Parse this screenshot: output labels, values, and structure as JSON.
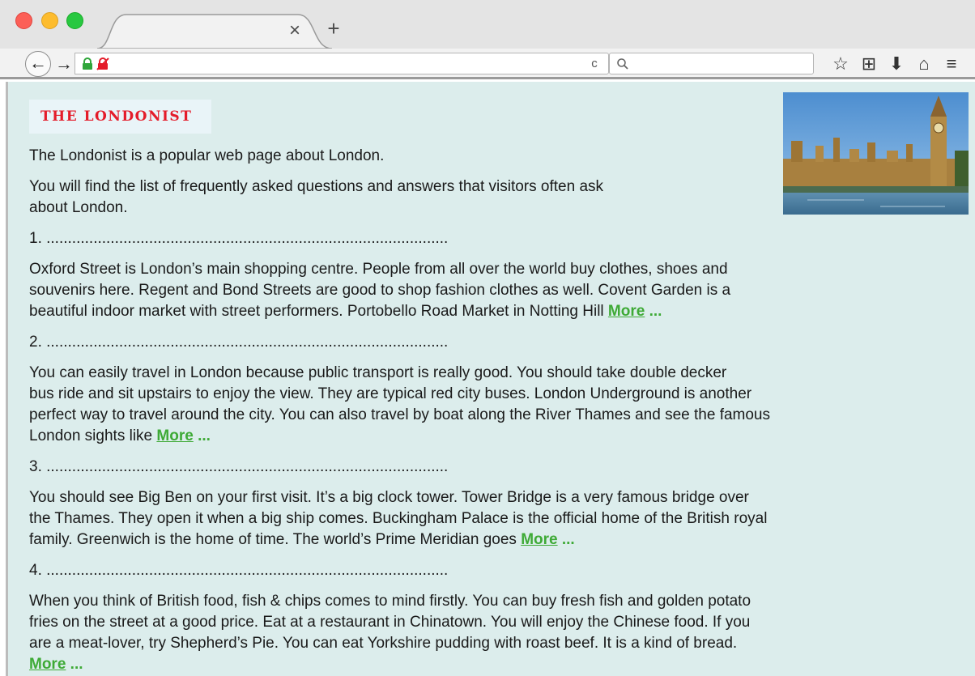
{
  "browser": {
    "tab": {
      "close_glyph": "×",
      "new_glyph": "+"
    },
    "nav": {
      "back_glyph": "←",
      "forward_glyph": "→",
      "reload_glyph": "c"
    },
    "toolbar_icons": [
      "star-icon",
      "reading-list-icon",
      "download-icon",
      "home-icon",
      "menu-icon"
    ],
    "toolbar_glyphs": [
      "☆",
      "⊞",
      "⬇",
      "⌂",
      "≡"
    ]
  },
  "page": {
    "logo": "THE LONDONIST",
    "intro_1": "The Londonist is a popular web page about London.",
    "intro_2_line1": "You will find the list of frequently asked questions and answers that visitors often ask",
    "intro_2_line2": "about London.",
    "more_label": "More",
    "more_dots": " ...",
    "sections": [
      {
        "blank": "1. ..............................................................................................",
        "lines": [
          "Oxford Street is London’s main shopping centre. People from all over the world buy clothes, shoes and",
          "souvenirs here. Regent and Bond Streets are good to shop fashion clothes as well. Covent Garden is a",
          "beautiful indoor market with street performers. Portobello Road Market in Notting Hill "
        ]
      },
      {
        "blank": "2. ..............................................................................................",
        "lines": [
          "You can easily travel in London because public transport is really good. You should take double decker",
          "bus ride and sit upstairs to enjoy the view. They are typical red city buses. London Underground is another",
          "perfect way to travel around the city. You can also travel by boat along the River Thames and see the famous",
          "London sights like "
        ]
      },
      {
        "blank": "3. ..............................................................................................",
        "lines": [
          "You should see Big Ben on your first visit. It’s a big clock tower. Tower Bridge is a very famous bridge over",
          "the Thames. They open it when a big ship comes. Buckingham Palace is the official home of the British royal",
          "family. Greenwich is the home of time. The world’s Prime Meridian goes "
        ]
      },
      {
        "blank": "4. ..............................................................................................",
        "lines": [
          "When you think of British food, fish & chips comes to mind firstly. You can buy fresh fish and golden potato",
          "fries on the street at a good price. Eat at a restaurant in Chinatown. You will enjoy the Chinese food. If you",
          "are a meat-lover, try Shepherd’s Pie. You can eat Yorkshire pudding with roast beef. It is a kind of bread."
        ]
      }
    ]
  },
  "colors": {
    "page_bg": "#dcedec",
    "logo_red": "#e41c2a",
    "more_green": "#3eaa36"
  }
}
